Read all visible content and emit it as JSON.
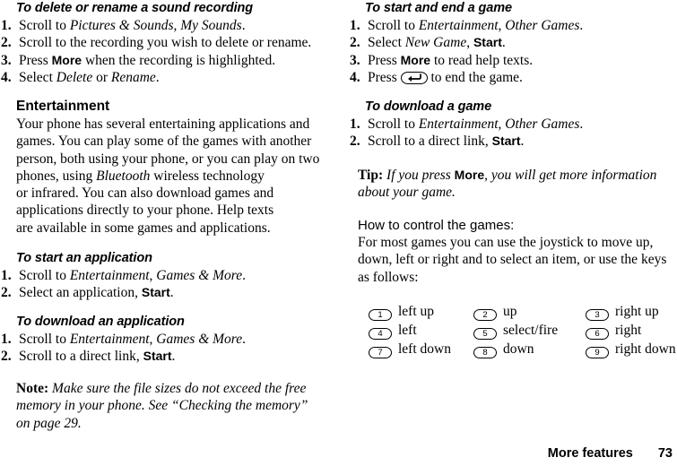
{
  "document": {
    "footer": {
      "section_title": "More features",
      "page_number": "73"
    }
  },
  "left_column": {
    "proc1": {
      "heading": "To delete or rename a sound recording",
      "steps": [
        {
          "num": "1.",
          "pre": "Scroll to ",
          "em1": "Pictures & Sounds",
          "mid": ", ",
          "em2": "My Sounds",
          "post": "."
        },
        {
          "num": "2.",
          "pre": "Scroll to the recording you wish to delete or rename.",
          "em1": "",
          "mid": "",
          "em2": "",
          "post": ""
        },
        {
          "num": "3.",
          "pre": "Press ",
          "key": "More",
          "post": " when the recording is highlighted."
        },
        {
          "num": "4.",
          "pre": "Select ",
          "em1": "Delete",
          "mid": " or ",
          "em2": "Rename",
          "post": "."
        }
      ]
    },
    "entertainment": {
      "heading": "Entertainment",
      "body_lines": [
        "Your phone has several entertaining applications and",
        "games. You can play some of the games with another",
        "person, both using your phone, or you can play on two",
        "phones, using BLUETOOTH wireless technology",
        "or infrared. You can also download games and",
        "applications directly to your phone. Help texts",
        "are available in some games and applications."
      ],
      "italic_term": "Bluetooth"
    },
    "proc2": {
      "heading": "To start an application",
      "steps": [
        {
          "num": "1.",
          "pre": "Scroll to ",
          "em1": "Entertainment",
          "mid": ", ",
          "em2": "Games & More",
          "post": "."
        },
        {
          "num": "2.",
          "pre": "Select an application, ",
          "key": "Start",
          "post": "."
        }
      ]
    },
    "proc3": {
      "heading": "To download an application",
      "steps": [
        {
          "num": "1.",
          "pre": "Scroll to ",
          "em1": "Entertainment",
          "mid": ", ",
          "em2": "Games & More",
          "post": "."
        },
        {
          "num": "2.",
          "pre": "Scroll to a direct link, ",
          "key": "Start",
          "post": "."
        }
      ]
    },
    "note": {
      "lead": "Note:",
      "line1": " Make sure the file sizes do not exceed the free",
      "line2": "memory in your phone. See “Checking the memory”",
      "line3": "on page 29."
    }
  },
  "right_column": {
    "proc4": {
      "heading": "To start and end a game",
      "steps": [
        {
          "num": "1.",
          "pre": "Scroll to ",
          "em1": "Entertainment",
          "mid": ", ",
          "em2": "Other Games",
          "post": "."
        },
        {
          "num": "2.",
          "pre": "Select ",
          "em1": "New Game",
          "mid": ", ",
          "key": "Start",
          "post": "."
        },
        {
          "num": "3.",
          "pre": "Press ",
          "key": "More",
          "post": " to read help texts."
        },
        {
          "num": "4.",
          "pre": "Press ",
          "icon": "back-arrow-key-icon",
          "post": " to end the game."
        }
      ]
    },
    "proc5": {
      "heading": "To download a game",
      "steps": [
        {
          "num": "1.",
          "pre": "Scroll to ",
          "em1": "Entertainment",
          "mid": ", ",
          "em2": "Other Games",
          "post": "."
        },
        {
          "num": "2.",
          "pre": "Scroll to a direct link, ",
          "key": "Start",
          "post": "."
        }
      ]
    },
    "tip": {
      "lead": "Tip:",
      "part1": " If you press ",
      "key": "More",
      "part2": ", you will get more information",
      "line2": "about your game."
    },
    "controls": {
      "heading": "How to control the games:",
      "body_lines": [
        "For most games you can use the joystick to move up,",
        "down, left or right and to select an item, or use the keys",
        "as follows:"
      ],
      "key_rows": [
        [
          {
            "key": "1",
            "label": "left up"
          },
          {
            "key": "2",
            "label": "up"
          },
          {
            "key": "3",
            "label": "right up"
          }
        ],
        [
          {
            "key": "4",
            "label": "left"
          },
          {
            "key": "5",
            "label": "select/fire"
          },
          {
            "key": "6",
            "label": "right"
          }
        ],
        [
          {
            "key": "7",
            "label": "left down"
          },
          {
            "key": "8",
            "label": "down"
          },
          {
            "key": "9",
            "label": "right down"
          }
        ]
      ]
    }
  }
}
